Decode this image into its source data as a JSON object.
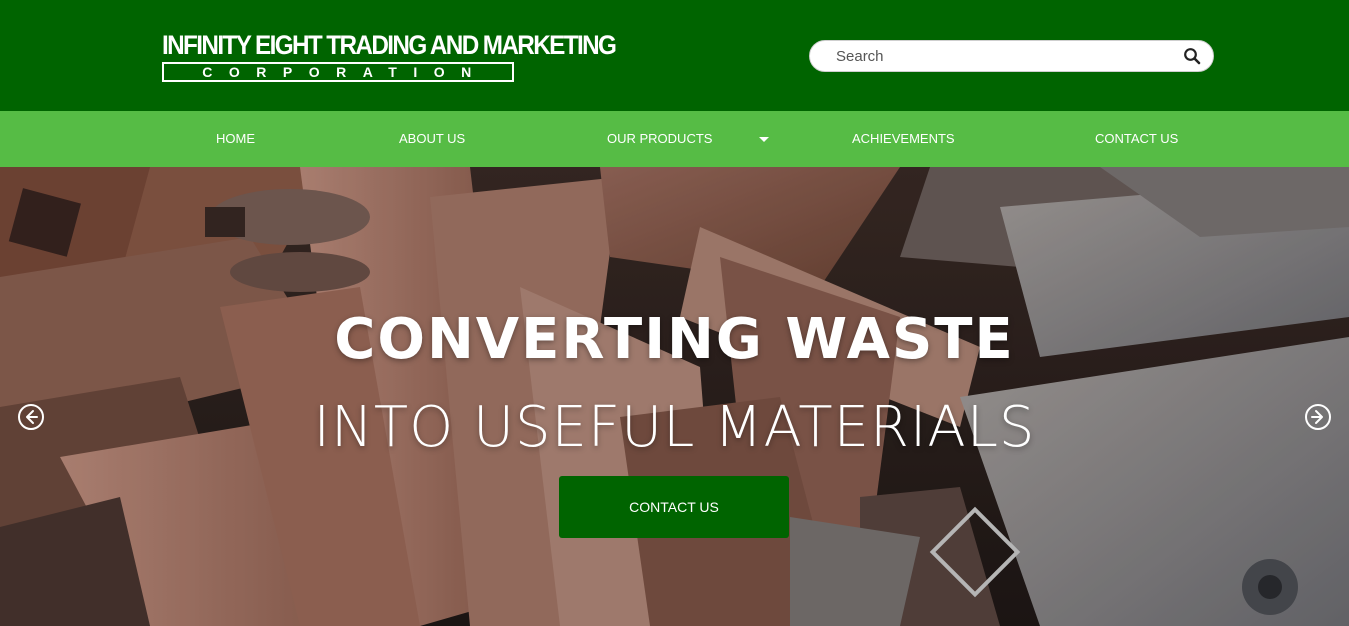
{
  "header": {
    "logo_line1": "INFINITY EIGHT TRADING AND MARKETING",
    "logo_line2": "CORPORATION",
    "search": {
      "placeholder": "Search"
    }
  },
  "nav": {
    "items": [
      {
        "label": "HOME"
      },
      {
        "label": "ABOUT US"
      },
      {
        "label": "OUR PRODUCTS",
        "has_dropdown": true
      },
      {
        "label": "ACHIEVEMENTS"
      },
      {
        "label": "CONTACT US"
      }
    ]
  },
  "hero": {
    "title": "CONVERTING WASTE",
    "subtitle": "INTO USEFUL MATERIALS",
    "button_label": "CONTACT US"
  },
  "colors": {
    "header_bg": "#006400",
    "nav_bg": "#56bc45",
    "button_bg": "#006400",
    "text": "#ffffff"
  },
  "icons": {
    "search": "search-icon",
    "prev": "arrow-left-circle-icon",
    "next": "arrow-right-circle-icon",
    "dropdown": "caret-down-icon"
  }
}
